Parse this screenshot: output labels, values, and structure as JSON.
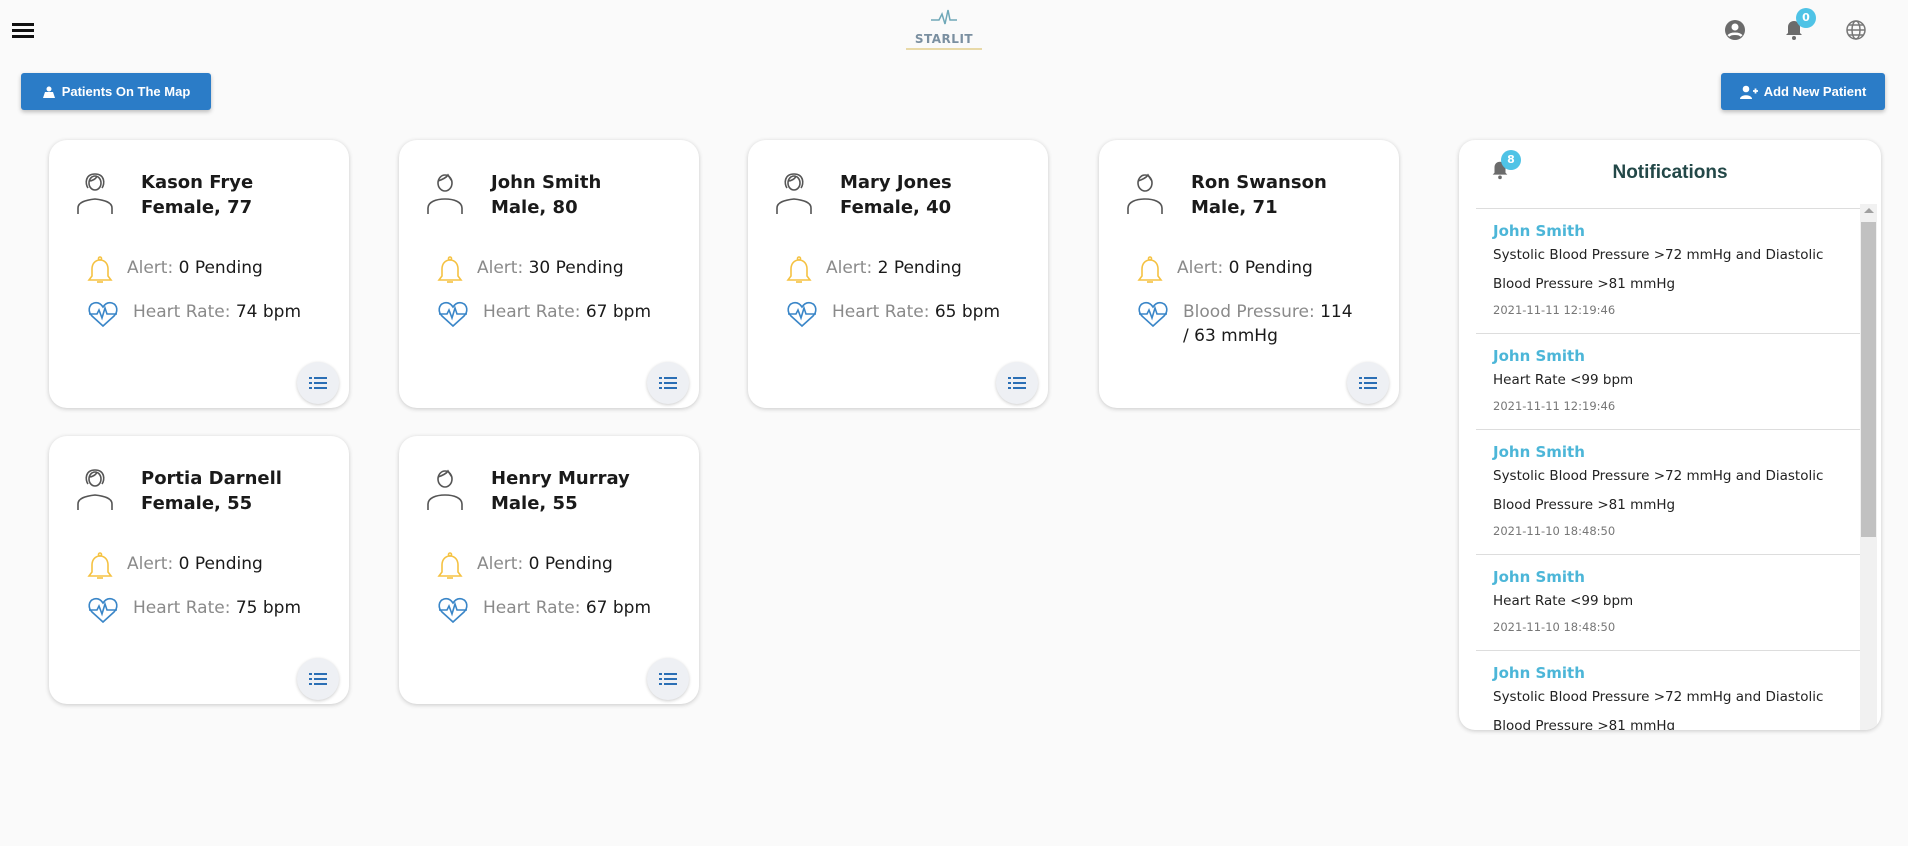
{
  "header": {
    "logo_text": "STARLIT",
    "notification_count": "0"
  },
  "toolbar": {
    "map_label": "Patients On The Map",
    "add_label": "Add New Patient"
  },
  "colors": {
    "primary": "#2b7cc7",
    "badge": "#4fc3e6",
    "alert_icon": "#f5c242",
    "heart_icon": "#3a86c8"
  },
  "patients": [
    {
      "name": "Kason Frye",
      "info": "Female, 77",
      "gender": "female",
      "alert_label": "Alert:",
      "alert_value": "0 Pending",
      "metric_label": "Heart Rate:",
      "metric_value": "74 bpm"
    },
    {
      "name": "John Smith",
      "info": "Male, 80",
      "gender": "male",
      "alert_label": "Alert:",
      "alert_value": "30 Pending",
      "metric_label": "Heart Rate:",
      "metric_value": "67 bpm"
    },
    {
      "name": "Mary Jones",
      "info": "Female, 40",
      "gender": "female",
      "alert_label": "Alert:",
      "alert_value": "2 Pending",
      "metric_label": "Heart Rate:",
      "metric_value": "65 bpm"
    },
    {
      "name": "Ron Swanson",
      "info": "Male, 71",
      "gender": "male",
      "alert_label": "Alert:",
      "alert_value": "0 Pending",
      "metric_label": "Blood Pressure:",
      "metric_value": "114 / 63 mmHg"
    },
    {
      "name": "Portia Darnell",
      "info": "Female, 55",
      "gender": "female",
      "alert_label": "Alert:",
      "alert_value": "0 Pending",
      "metric_label": "Heart Rate:",
      "metric_value": "75 bpm"
    },
    {
      "name": "Henry Murray",
      "info": "Male, 55",
      "gender": "male",
      "alert_label": "Alert:",
      "alert_value": "0 Pending",
      "metric_label": "Heart Rate:",
      "metric_value": "67 bpm"
    }
  ],
  "notifications": {
    "title": "Notifications",
    "count": "8",
    "items": [
      {
        "name": "John Smith",
        "message": "Systolic Blood Pressure >72 mmHg and Diastolic Blood Pressure >81 mmHg",
        "time": "2021-11-11 12:19:46"
      },
      {
        "name": "John Smith",
        "message": "Heart Rate <99 bpm",
        "time": "2021-11-11 12:19:46"
      },
      {
        "name": "John Smith",
        "message": "Systolic Blood Pressure >72 mmHg and Diastolic Blood Pressure >81 mmHg",
        "time": "2021-11-10 18:48:50"
      },
      {
        "name": "John Smith",
        "message": "Heart Rate <99 bpm",
        "time": "2021-11-10 18:48:50"
      },
      {
        "name": "John Smith",
        "message": "Systolic Blood Pressure >72 mmHg and Diastolic Blood Pressure >81 mmHg",
        "time": ""
      }
    ]
  }
}
